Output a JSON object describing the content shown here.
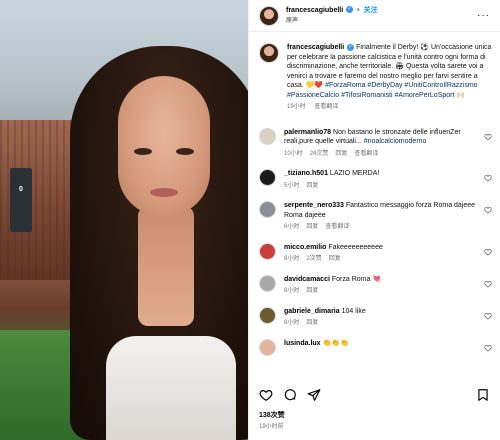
{
  "post": {
    "username": "francescagiubelli",
    "follow_label": "关注",
    "subtitle": "原声",
    "more_label": "···"
  },
  "caption": {
    "username": "francescagiubelli",
    "text_1": "Finalmente il Derby! ⚽ Un'occasione unica per celebrare la passione calcistica e l'unità contro ogni forma di discriminazione, anche territoriale. 🏟 Questa volta sarete voi a venirci a trovare e faremo del nostro meglio per farvi sentire a casa. 💛❤️",
    "hashtags": "#ForzaRoma #DerbyDay #UnitiControIlRazzismo #PassioneCalcio #TifosiRomanisti #AmorePerLoSport 🙌🏻",
    "time": "19小时",
    "translate": "查看翻译"
  },
  "comments": [
    {
      "username": "palermanlio78",
      "text": "Non bastano le stronzate delle influenZer reali,pure quelle virtuali...",
      "tag": "#noalcalciomoderno",
      "time": "10小时",
      "likes": "24次赞",
      "reply": "回复",
      "translate": "查看翻译",
      "avatar_color": "#d9d1c4"
    },
    {
      "username": "_tiziano.h501",
      "text": "LAZIO MERDA!",
      "tag": "",
      "time": "5小时",
      "likes": "",
      "reply": "回复",
      "translate": "",
      "avatar_color": "#1a1a1a"
    },
    {
      "username": "serpente_nero333",
      "text": "Fantastico messaggio forza Roma dajeee Roma dajeee",
      "tag": "",
      "time": "6小时",
      "likes": "",
      "reply": "回复",
      "translate": "查看翻译",
      "avatar_color": "#8a8f96"
    },
    {
      "username": "micco.emilio",
      "text": "Fakeeeeeeeeeee",
      "tag": "",
      "time": "8小时",
      "likes": "2次赞",
      "reply": "回复",
      "translate": "",
      "avatar_color": "#c9403a"
    },
    {
      "username": "davidcamacci",
      "text": "Forza Roma 💘",
      "tag": "",
      "time": "8小时",
      "likes": "",
      "reply": "回复",
      "translate": "",
      "avatar_color": "#a9a9a9"
    },
    {
      "username": "gabriele_dimaria",
      "text": "104 like",
      "tag": "",
      "time": "8小时",
      "likes": "",
      "reply": "回复",
      "translate": "",
      "avatar_color": "#6f5a2e"
    },
    {
      "username": "lusinda.lux",
      "text": "👏👏👏",
      "tag": "",
      "time": "",
      "likes": "",
      "reply": "",
      "translate": "",
      "avatar_color": "#e3b49b"
    }
  ],
  "footer": {
    "likes": "138次赞",
    "time": "19小时前"
  },
  "media": {
    "scoreboard_text": "0"
  }
}
